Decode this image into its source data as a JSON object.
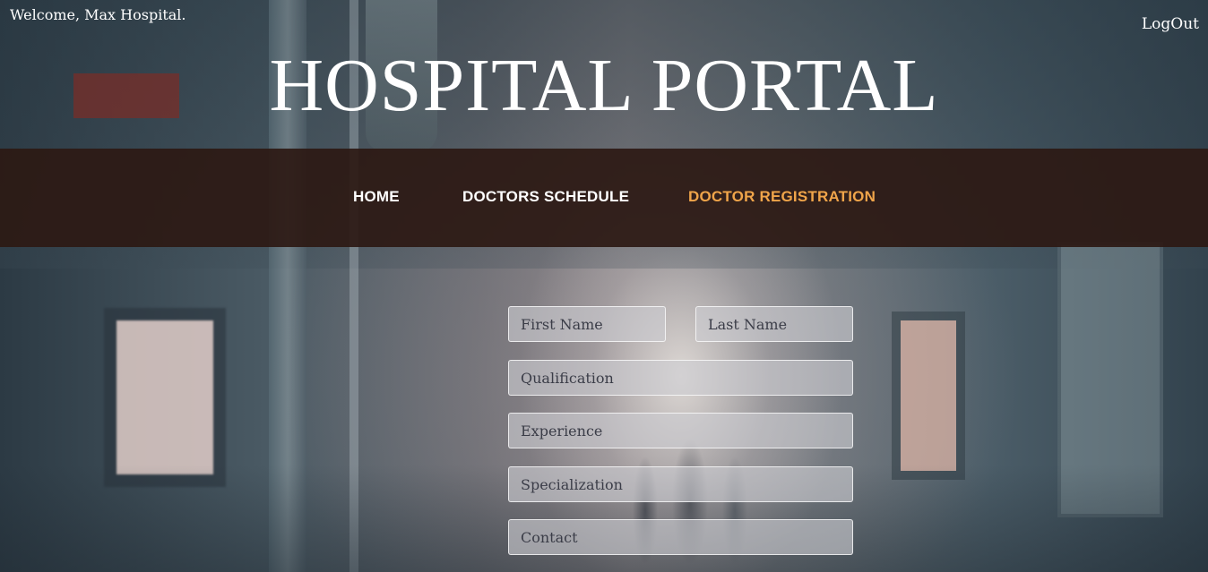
{
  "header": {
    "welcome_text": "Welcome, Max Hospital.",
    "logout_label": "LogOut",
    "site_title": "HOSPITAL PORTAL"
  },
  "nav": {
    "items": [
      {
        "label": "HOME",
        "active": false
      },
      {
        "label": "DOCTORS SCHEDULE",
        "active": false
      },
      {
        "label": "DOCTOR REGISTRATION",
        "active": true
      }
    ],
    "active_color": "#f0a54a",
    "background_color": "#2d1914"
  },
  "form": {
    "first_name": {
      "value": "",
      "placeholder": "First Name"
    },
    "last_name": {
      "value": "",
      "placeholder": "Last Name"
    },
    "qualification": {
      "value": "",
      "placeholder": "Qualification"
    },
    "experience": {
      "value": "",
      "placeholder": "Experience"
    },
    "specialization": {
      "value": "",
      "placeholder": "Specialization"
    },
    "contact": {
      "value": "",
      "placeholder": "Contact"
    }
  }
}
